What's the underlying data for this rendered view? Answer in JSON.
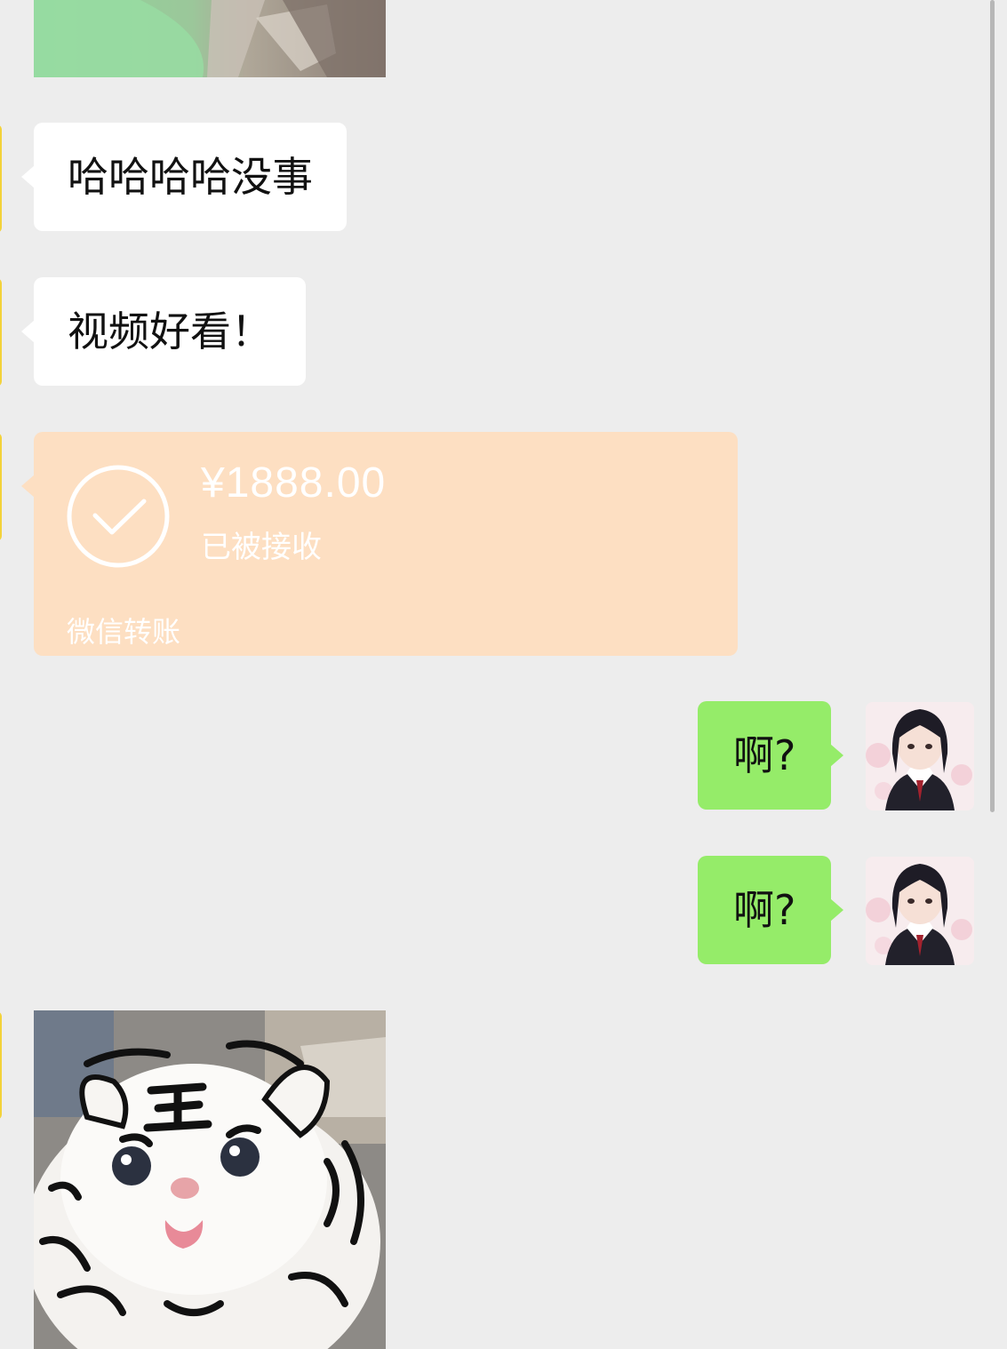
{
  "messages": [
    {
      "type": "image",
      "from": "contact"
    },
    {
      "type": "text",
      "from": "contact",
      "text": "哈哈哈哈没事"
    },
    {
      "type": "text",
      "from": "contact",
      "text": "视频好看！"
    },
    {
      "type": "transfer",
      "from": "contact",
      "amount": "¥1888.00",
      "status": "已被接收",
      "footer": "微信转账"
    },
    {
      "type": "text",
      "from": "me",
      "text": "啊?"
    },
    {
      "type": "text",
      "from": "me",
      "text": "啊?"
    },
    {
      "type": "image",
      "from": "contact",
      "sticker_text": "王"
    }
  ],
  "colors": {
    "background": "#ededed",
    "incoming_bubble": "#ffffff",
    "outgoing_bubble": "#95ec69",
    "transfer_card": "#fddfc2",
    "contact_avatar_edge": "#f3d23a"
  }
}
